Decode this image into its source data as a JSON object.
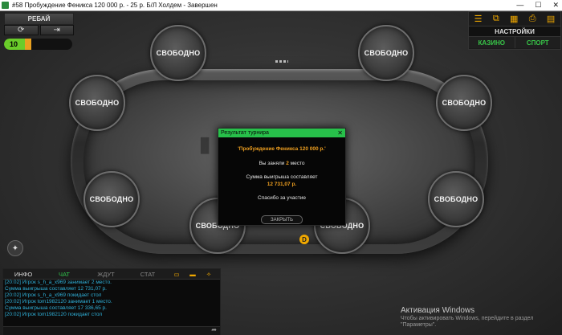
{
  "window": {
    "title": "#58 Пробуждение Феникса 120 000 р. - 25 р. Б/Л Холдем - Завершен"
  },
  "topleft": {
    "rebuy_label": "РЕБАЙ",
    "timer_value": "10"
  },
  "topright": {
    "settings_label": "НАСТРОЙКИ",
    "casino_label": "КАЗИНО",
    "sport_label": "СПОРТ"
  },
  "seats": [
    {
      "label": "СВОБОДНО"
    },
    {
      "label": "СВОБОДНО"
    },
    {
      "label": "СВОБОДНО"
    },
    {
      "label": "СВОБОДНО"
    },
    {
      "label": "СВОБОДНО"
    },
    {
      "label": "СВОБОДНО"
    },
    {
      "label": "СВОБОДНО"
    },
    {
      "label": "СВОБОДНО"
    },
    {
      "label": "СВОБОДНО"
    }
  ],
  "dealer_label": "D",
  "dialog": {
    "title": "Результат турнира",
    "tournament_name": "'Пробуждение Феникса 120 000 р.'",
    "place_prefix": "Вы заняли",
    "place_number": "2",
    "place_suffix": "место",
    "win_text": "Сумма выигрыша составляет",
    "win_amount": "12 731,07 р.",
    "thanks": "Спасибо за участие",
    "close_label": "ЗАКРЫТЬ"
  },
  "chat": {
    "tabs": [
      "ИНФО",
      "ЧАТ",
      "ЖДУТ",
      "СТАТ"
    ],
    "messages": [
      "[20:02] Игрок s_h_a_x969 занимает 2 место.",
      "Сумма выигрыша составляет 12 731,07 р.",
      "[20:02] Игрок s_h_a_x969 покидает стол",
      "[20:02] Игрок tom1982120 занимает 1 место.",
      "Сумма выигрыша составляет 17 336,65 р.",
      "[20:02] Игрок tom1982120 покидает стол"
    ]
  },
  "activation": {
    "title": "Активация Windows",
    "subtitle1": "Чтобы активировать Windows, перейдите в раздел",
    "subtitle2": "\"Параметры\"."
  }
}
